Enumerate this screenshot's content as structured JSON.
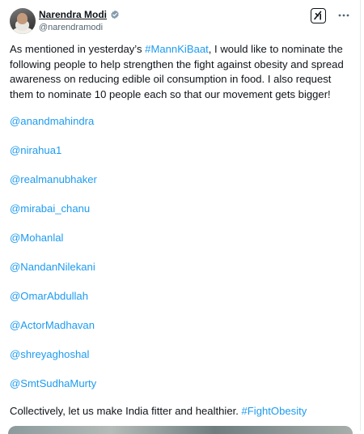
{
  "author": {
    "name": "Narendra Modi",
    "handle": "@narendramodi",
    "verified": true
  },
  "icons": {
    "verified": "verified-badge-icon",
    "grok": "grok-icon",
    "more": "more-options-icon"
  },
  "post": {
    "intro_before": "As mentioned in yesterday’s ",
    "intro_hashtag": "#MannKiBaat",
    "intro_after": ", I would like to nominate the following people to help strengthen the fight against obesity and spread awareness on reducing edible oil consumption in food. I also request them to nominate 10 people each so that our movement gets bigger!",
    "mentions": [
      "@anandmahindra",
      "@nirahua1",
      "@realmanubhaker",
      "@mirabai_chanu",
      "@Mohanlal",
      "@NandanNilekani",
      "@OmarAbdullah",
      "@ActorMadhavan",
      "@shreyaghoshal",
      "@SmtSudhaMurty"
    ],
    "closing_text": "Collectively, let us make India fitter and healthier. ",
    "closing_hashtag": "#FightObesity"
  },
  "colors": {
    "link": "#1d9bf0",
    "text": "#0f1419",
    "secondary": "#536471",
    "verified": "#829aab"
  }
}
